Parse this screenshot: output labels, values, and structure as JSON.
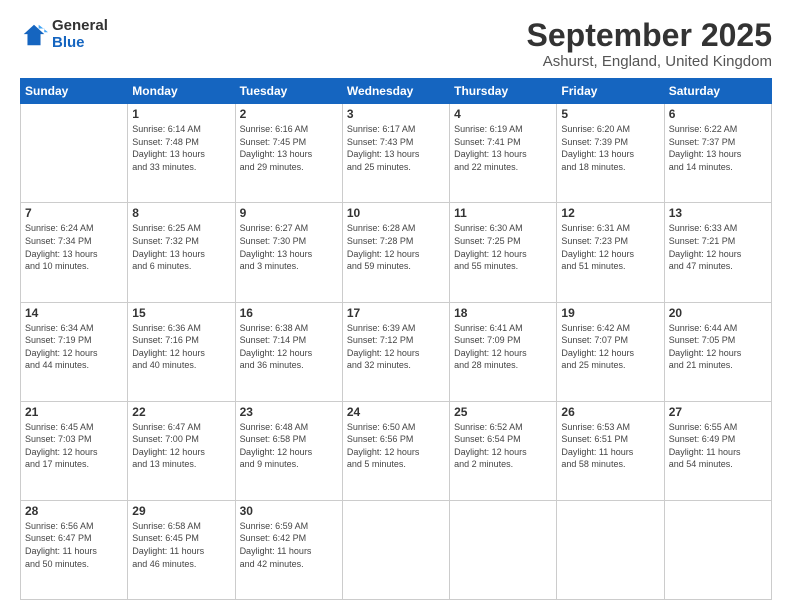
{
  "logo": {
    "general": "General",
    "blue": "Blue"
  },
  "header": {
    "month": "September 2025",
    "location": "Ashurst, England, United Kingdom"
  },
  "days": [
    "Sunday",
    "Monday",
    "Tuesday",
    "Wednesday",
    "Thursday",
    "Friday",
    "Saturday"
  ],
  "weeks": [
    [
      {
        "day": "",
        "info": ""
      },
      {
        "day": "1",
        "info": "Sunrise: 6:14 AM\nSunset: 7:48 PM\nDaylight: 13 hours\nand 33 minutes."
      },
      {
        "day": "2",
        "info": "Sunrise: 6:16 AM\nSunset: 7:45 PM\nDaylight: 13 hours\nand 29 minutes."
      },
      {
        "day": "3",
        "info": "Sunrise: 6:17 AM\nSunset: 7:43 PM\nDaylight: 13 hours\nand 25 minutes."
      },
      {
        "day": "4",
        "info": "Sunrise: 6:19 AM\nSunset: 7:41 PM\nDaylight: 13 hours\nand 22 minutes."
      },
      {
        "day": "5",
        "info": "Sunrise: 6:20 AM\nSunset: 7:39 PM\nDaylight: 13 hours\nand 18 minutes."
      },
      {
        "day": "6",
        "info": "Sunrise: 6:22 AM\nSunset: 7:37 PM\nDaylight: 13 hours\nand 14 minutes."
      }
    ],
    [
      {
        "day": "7",
        "info": "Sunrise: 6:24 AM\nSunset: 7:34 PM\nDaylight: 13 hours\nand 10 minutes."
      },
      {
        "day": "8",
        "info": "Sunrise: 6:25 AM\nSunset: 7:32 PM\nDaylight: 13 hours\nand 6 minutes."
      },
      {
        "day": "9",
        "info": "Sunrise: 6:27 AM\nSunset: 7:30 PM\nDaylight: 13 hours\nand 3 minutes."
      },
      {
        "day": "10",
        "info": "Sunrise: 6:28 AM\nSunset: 7:28 PM\nDaylight: 12 hours\nand 59 minutes."
      },
      {
        "day": "11",
        "info": "Sunrise: 6:30 AM\nSunset: 7:25 PM\nDaylight: 12 hours\nand 55 minutes."
      },
      {
        "day": "12",
        "info": "Sunrise: 6:31 AM\nSunset: 7:23 PM\nDaylight: 12 hours\nand 51 minutes."
      },
      {
        "day": "13",
        "info": "Sunrise: 6:33 AM\nSunset: 7:21 PM\nDaylight: 12 hours\nand 47 minutes."
      }
    ],
    [
      {
        "day": "14",
        "info": "Sunrise: 6:34 AM\nSunset: 7:19 PM\nDaylight: 12 hours\nand 44 minutes."
      },
      {
        "day": "15",
        "info": "Sunrise: 6:36 AM\nSunset: 7:16 PM\nDaylight: 12 hours\nand 40 minutes."
      },
      {
        "day": "16",
        "info": "Sunrise: 6:38 AM\nSunset: 7:14 PM\nDaylight: 12 hours\nand 36 minutes."
      },
      {
        "day": "17",
        "info": "Sunrise: 6:39 AM\nSunset: 7:12 PM\nDaylight: 12 hours\nand 32 minutes."
      },
      {
        "day": "18",
        "info": "Sunrise: 6:41 AM\nSunset: 7:09 PM\nDaylight: 12 hours\nand 28 minutes."
      },
      {
        "day": "19",
        "info": "Sunrise: 6:42 AM\nSunset: 7:07 PM\nDaylight: 12 hours\nand 25 minutes."
      },
      {
        "day": "20",
        "info": "Sunrise: 6:44 AM\nSunset: 7:05 PM\nDaylight: 12 hours\nand 21 minutes."
      }
    ],
    [
      {
        "day": "21",
        "info": "Sunrise: 6:45 AM\nSunset: 7:03 PM\nDaylight: 12 hours\nand 17 minutes."
      },
      {
        "day": "22",
        "info": "Sunrise: 6:47 AM\nSunset: 7:00 PM\nDaylight: 12 hours\nand 13 minutes."
      },
      {
        "day": "23",
        "info": "Sunrise: 6:48 AM\nSunset: 6:58 PM\nDaylight: 12 hours\nand 9 minutes."
      },
      {
        "day": "24",
        "info": "Sunrise: 6:50 AM\nSunset: 6:56 PM\nDaylight: 12 hours\nand 5 minutes."
      },
      {
        "day": "25",
        "info": "Sunrise: 6:52 AM\nSunset: 6:54 PM\nDaylight: 12 hours\nand 2 minutes."
      },
      {
        "day": "26",
        "info": "Sunrise: 6:53 AM\nSunset: 6:51 PM\nDaylight: 11 hours\nand 58 minutes."
      },
      {
        "day": "27",
        "info": "Sunrise: 6:55 AM\nSunset: 6:49 PM\nDaylight: 11 hours\nand 54 minutes."
      }
    ],
    [
      {
        "day": "28",
        "info": "Sunrise: 6:56 AM\nSunset: 6:47 PM\nDaylight: 11 hours\nand 50 minutes."
      },
      {
        "day": "29",
        "info": "Sunrise: 6:58 AM\nSunset: 6:45 PM\nDaylight: 11 hours\nand 46 minutes."
      },
      {
        "day": "30",
        "info": "Sunrise: 6:59 AM\nSunset: 6:42 PM\nDaylight: 11 hours\nand 42 minutes."
      },
      {
        "day": "",
        "info": ""
      },
      {
        "day": "",
        "info": ""
      },
      {
        "day": "",
        "info": ""
      },
      {
        "day": "",
        "info": ""
      }
    ]
  ]
}
